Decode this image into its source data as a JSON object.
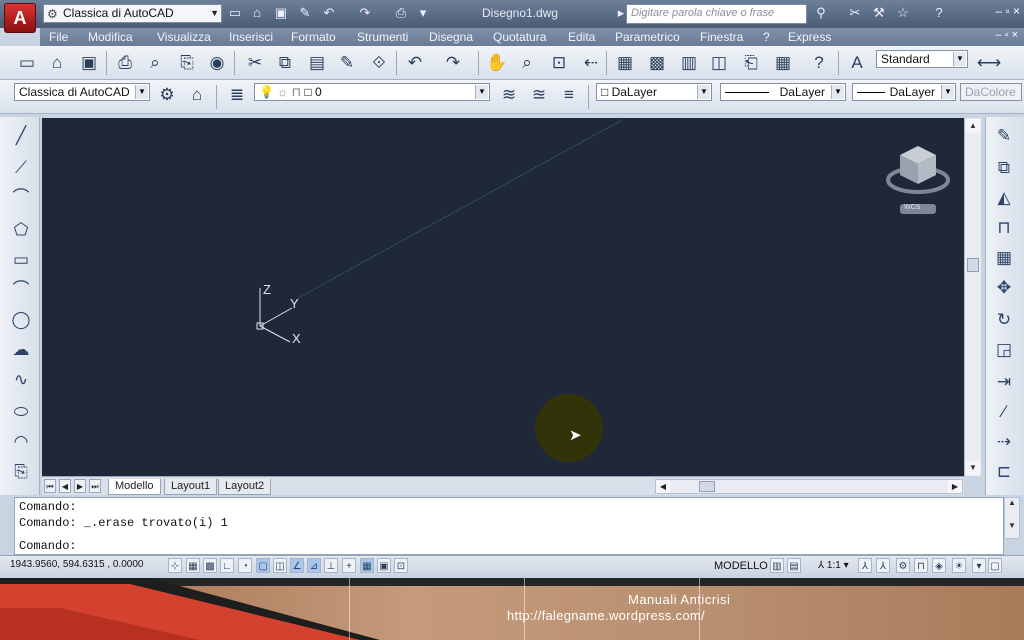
{
  "titlebar": {
    "app_button": "A",
    "workspace": "Classica di AutoCAD",
    "document_title": "Disegno1.dwg",
    "search_placeholder": "Digitare parola chiave o frase",
    "window_controls": "– ▫ ×"
  },
  "menu": {
    "items": [
      "File",
      "Modifica",
      "Visualizza",
      "Inserisci",
      "Formato",
      "Strumenti",
      "Disegna",
      "Quotatura",
      "Edita",
      "Parametrico",
      "Finestra",
      "?",
      "Express"
    ],
    "mdi_controls": "– ▫ ×"
  },
  "toolbar_styles": {
    "text_style": "Standard"
  },
  "toolbar_layers": {
    "workspace": "Classica di AutoCAD",
    "layer": "0",
    "color": "DaLayer",
    "linetype": "DaLayer",
    "lineweight": "DaLayer",
    "plotstyle": "DaColore"
  },
  "ucs": {
    "z": "Z",
    "y": "Y",
    "x": "X"
  },
  "viewcube": {
    "wcs_label": "WCS"
  },
  "tabs": {
    "items": [
      "Modello",
      "Layout1",
      "Layout2"
    ],
    "active": "Modello"
  },
  "command": {
    "history": [
      "Comando:",
      "Comando: _.erase trovato(i) 1"
    ],
    "prompt": "Comando:"
  },
  "status": {
    "coordinates": "1943.9560, 594.6315 , 0.0000",
    "space": "MODELLO",
    "scale": "1:1"
  },
  "footer": {
    "title": "Manuali Anticrisi",
    "url": "http://falegname.wordpress.com/"
  },
  "colors": {
    "drawing_background": "#1f2838",
    "title_bar": "#4b5b75",
    "app_button": "#c62222"
  }
}
